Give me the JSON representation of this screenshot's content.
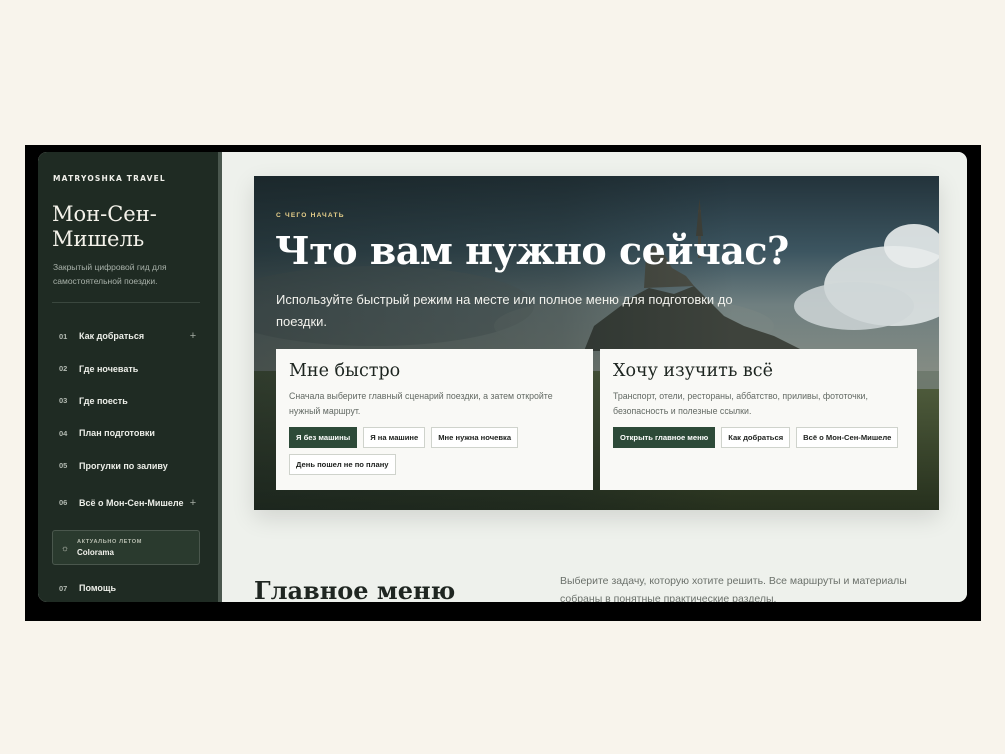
{
  "sidebar": {
    "brand": "MATRYOSHKA TRAVEL",
    "title": "Мон-Сен-Мишель",
    "subtitle": "Закрытый цифровой гид для самостоятельной поездки.",
    "items": [
      {
        "num": "01",
        "label": "Как добраться",
        "plus": "+"
      },
      {
        "num": "02",
        "label": "Где ночевать"
      },
      {
        "num": "03",
        "label": "Где поесть"
      },
      {
        "num": "04",
        "label": "План подготовки"
      },
      {
        "num": "05",
        "label": "Прогулки по заливу"
      },
      {
        "num": "06",
        "label": "Всё о Мон-Сен-Мишеле",
        "plus": "+"
      }
    ],
    "summer": {
      "icon": "sun-icon",
      "tag": "АКТУАЛЬНО ЛЕТОМ",
      "name": "Colorama"
    },
    "help": {
      "num": "07",
      "label": "Помощь"
    }
  },
  "hero": {
    "eyebrow": "С ЧЕГО НАЧАТЬ",
    "title": "Что вам нужно сейчас?",
    "text": "Используйте быстрый режим на месте или полное меню для подготовки до поездки."
  },
  "cards": [
    {
      "title": "Мне быстро",
      "text": "Сначала выберите главный сценарий поездки, а затем откройте нужный маршрут.",
      "buttons": [
        "Я без машины",
        "Я на машине",
        "Мне нужна ночевка",
        "День пошел не по плану"
      ]
    },
    {
      "title": "Хочу изучить всё",
      "text": "Транспорт, отели, рестораны, аббатство, приливы, фототочки, безопасность и полезные ссылки.",
      "buttons": [
        "Открыть главное меню",
        "Как добраться",
        "Всё о Мон-Сен-Мишеле"
      ]
    }
  ],
  "menu": {
    "title": "Главное меню",
    "description": "Выберите задачу, которую хотите решить. Все маршруты и материалы собраны в понятные практические разделы."
  },
  "colors": {
    "sidebar": "#1f2b23",
    "accent": "#2d4a38",
    "eyebrow": "#e6cf8a",
    "page": "#f8f4ec"
  }
}
